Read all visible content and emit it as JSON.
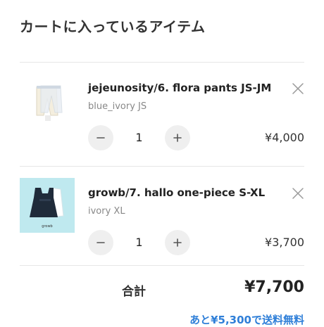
{
  "cart": {
    "title": "カートに入っているアイテム",
    "items": [
      {
        "name": "jejeunosity/6. flora pants JS-JM",
        "variant": "blue_ivory JS",
        "quantity": "1",
        "price": "¥4,000"
      },
      {
        "name": "growb/7. hallo one-piece S-XL",
        "variant": "ivory XL",
        "quantity": "1",
        "price": "¥3,700",
        "thumb_text": "growb"
      }
    ],
    "total_label": "合計",
    "total_value": "¥7,700",
    "shipping_note": "あと¥5,300で送料無料"
  },
  "icons": {
    "remove": "close-icon",
    "decrease": "minus-icon",
    "increase": "plus-icon"
  },
  "colors": {
    "accent_link": "#2f7fd8",
    "stepper_bg": "#efefef",
    "thumb2_bg": "#bfe9ef"
  }
}
